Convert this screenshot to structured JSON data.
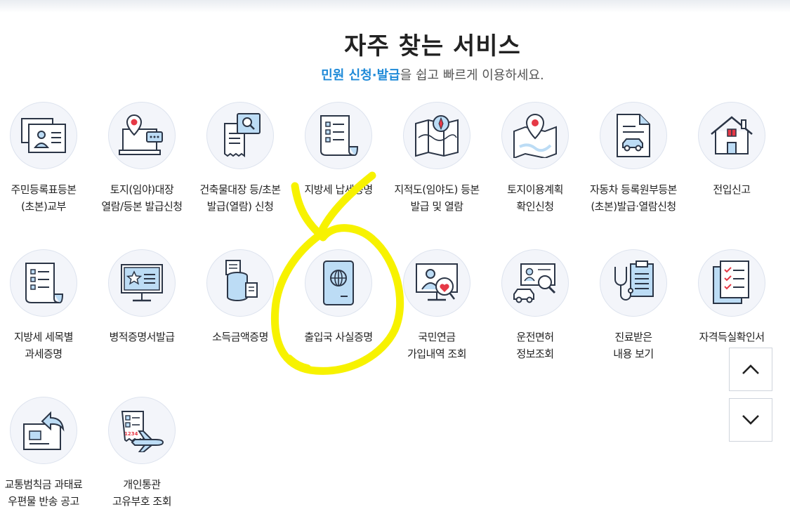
{
  "header": {
    "title": "자주 찾는 서비스",
    "subtitle_accent": "민원 신청·발급",
    "subtitle_rest": "을 쉽고 빠르게 이용하세요."
  },
  "services": [
    {
      "label": "주민등록표등본\n(초본)교부",
      "icon": "id-card-icon"
    },
    {
      "label": "토지(임야)대장\n열람/등본 발급신청",
      "icon": "laptop-location-icon"
    },
    {
      "label": "건축물대장 등/초본\n발급(열람) 신청",
      "icon": "receipt-search-icon"
    },
    {
      "label": "지방세 납세증명",
      "icon": "tax-document-icon"
    },
    {
      "label": "지적도(임야도) 등본\n발급 및 열람",
      "icon": "map-compass-icon"
    },
    {
      "label": "토지이용계획\n확인신청",
      "icon": "map-pin-icon"
    },
    {
      "label": "자동차 등록원부등본\n(초본)발급·열람신청",
      "icon": "car-document-icon"
    },
    {
      "label": "전입신고",
      "icon": "house-icon"
    },
    {
      "label": "지방세 세목별\n과세증명",
      "icon": "tax-list-icon"
    },
    {
      "label": "병적증명서발급",
      "icon": "military-monitor-icon"
    },
    {
      "label": "소득금액증명",
      "icon": "coins-document-icon"
    },
    {
      "label": "출입국 사실증명",
      "icon": "passport-icon"
    },
    {
      "label": "국민연금\n가입내역 조회",
      "icon": "pension-monitor-icon"
    },
    {
      "label": "운전면허\n정보조회",
      "icon": "license-search-icon"
    },
    {
      "label": "진료받은\n내용 보기",
      "icon": "medical-clipboard-icon"
    },
    {
      "label": "자격득실확인서",
      "icon": "checklist-icon"
    },
    {
      "label": "교통범칙금 과태료\n우편물 반송 공고",
      "icon": "returned-mail-icon"
    },
    {
      "label": "개인통관\n고유부호 조회",
      "icon": "customs-plane-icon"
    }
  ],
  "scroll": {
    "up_icon": "chevron-up-icon",
    "down_icon": "chevron-down-icon"
  },
  "colors": {
    "accent": "#1f8ad8",
    "highlight": "#f7f200",
    "icon_fill": "#bcdcf5",
    "icon_stroke": "#2b3546",
    "icon_red": "#e63946"
  }
}
